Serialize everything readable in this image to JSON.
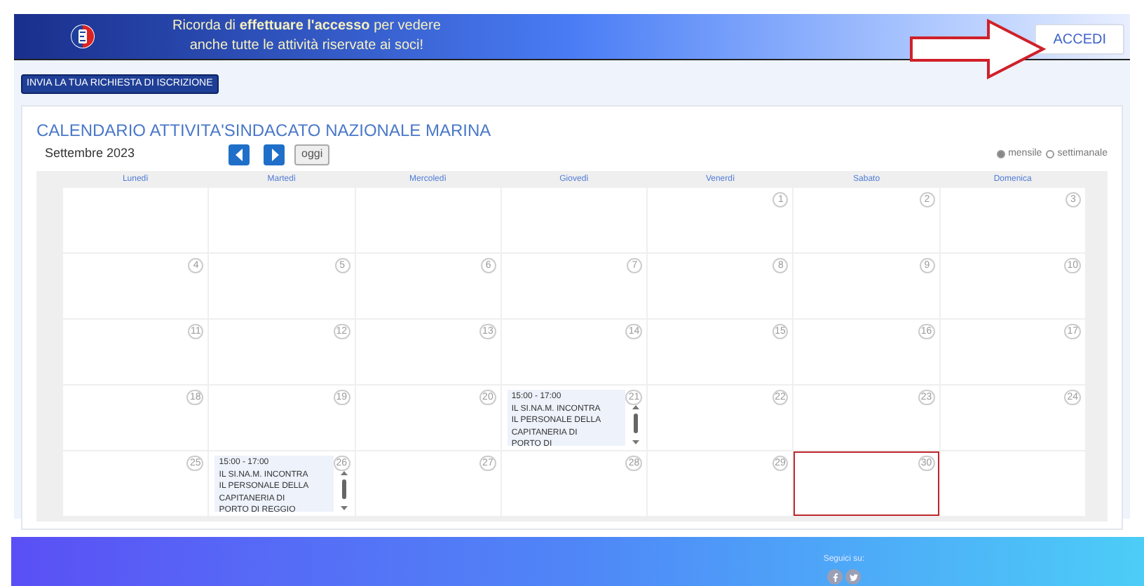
{
  "header": {
    "notice": "Ricorda di **effettuare l'accesso** per vedere",
    "notice_line2": "anche tutte le attività riservate ai soci!",
    "login_button": "ACCEDI"
  },
  "signup_button": "INVIA LA TUA RICHIESTA DI ISCRIZIONE",
  "calendar": {
    "title": "CALENDARIO ATTIVITA'SINDACATO NAZIONALE MARINA",
    "month": "Settembre 2023",
    "today_button": "oggi",
    "views": [
      {
        "label": "mensile",
        "selected": true
      },
      {
        "label": "settimanale",
        "selected": false
      }
    ],
    "weekdays": [
      "Lunedì",
      "Martedì",
      "Mercoledì",
      "Giovedì",
      "Venerdì",
      "Sabato",
      "Domenica"
    ],
    "cells": [
      {},
      {},
      {},
      {},
      {
        "number": "1",
        "selected": false
      },
      {
        "number": "2",
        "selected": false
      },
      {
        "number": "3",
        "selected": false
      },
      {
        "number": "4",
        "selected": false
      },
      {
        "number": "5",
        "selected": false
      },
      {
        "number": "6",
        "selected": false
      },
      {
        "number": "7",
        "selected": false
      },
      {
        "number": "8",
        "selected": false
      },
      {
        "number": "9",
        "selected": false
      },
      {
        "number": "10",
        "selected": false
      },
      {
        "number": "11",
        "selected": false
      },
      {
        "number": "12",
        "selected": false
      },
      {
        "number": "13",
        "selected": false
      },
      {
        "number": "14",
        "selected": false
      },
      {
        "number": "15",
        "selected": false
      },
      {
        "number": "16",
        "selected": false
      },
      {
        "number": "17",
        "selected": false
      },
      {
        "number": "18",
        "selected": false
      },
      {
        "number": "19",
        "selected": false
      },
      {
        "number": "20",
        "selected": false
      },
      {
        "number": "21",
        "selected": false,
        "event": {
          "time": "15:00 - 17:00",
          "lines": [
            "IL SI.NA.M. INCONTRA",
            "IL PERSONALE DELLA",
            "CAPITANERIA DI",
            "PORTO DI"
          ]
        }
      },
      {
        "number": "22",
        "selected": false
      },
      {
        "number": "23",
        "selected": false
      },
      {
        "number": "24",
        "selected": false
      },
      {
        "number": "25",
        "selected": false
      },
      {
        "number": "26",
        "selected": false,
        "event": {
          "time": "15:00 - 17:00",
          "lines": [
            "IL SI.NA.M. INCONTRA",
            "IL PERSONALE DELLA",
            "CAPITANERIA DI",
            "PORTO DI REGGIO"
          ]
        }
      },
      {
        "number": "27",
        "selected": false
      },
      {
        "number": "28",
        "selected": false
      },
      {
        "number": "29",
        "selected": false
      },
      {
        "number": "30",
        "selected": true
      },
      {}
    ]
  },
  "footer": {
    "follow_label": "Seguici su:"
  }
}
